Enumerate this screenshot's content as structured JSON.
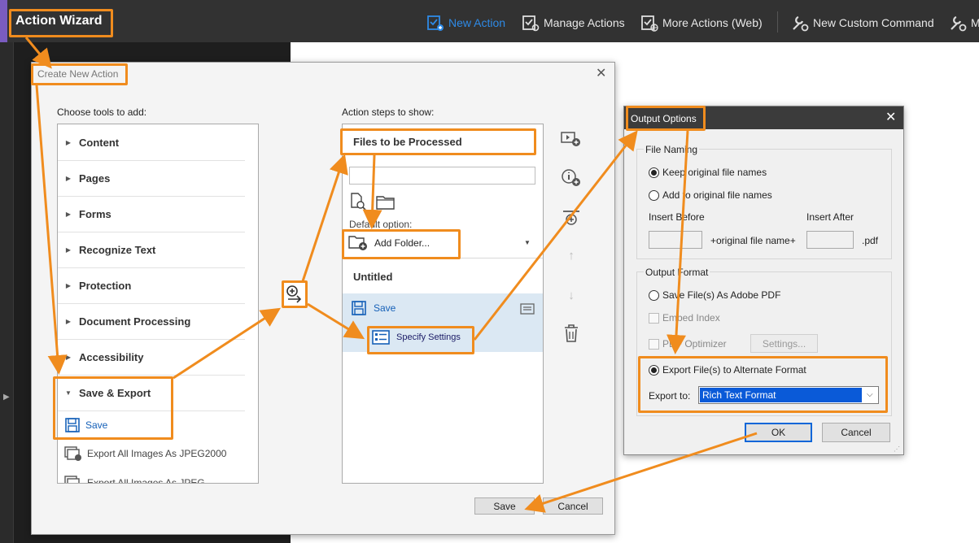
{
  "toolbar": {
    "title": "Action Wizard",
    "new_action": "New Action",
    "manage_actions": "Manage Actions",
    "more_actions": "More Actions (Web)",
    "new_custom_command": "New Custom Command",
    "cut_off_label": "M"
  },
  "create_dialog": {
    "title": "Create New Action",
    "choose_tools_label": "Choose tools to add:",
    "action_steps_label": "Action steps to show:",
    "categories": [
      "Content",
      "Pages",
      "Forms",
      "Recognize Text",
      "Protection",
      "Document Processing",
      "Accessibility",
      "Save & Export"
    ],
    "sub_items": [
      "Save",
      "Export All Images As JPEG2000",
      "Export All Images As JPEG"
    ],
    "files_header": "Files to be Processed",
    "default_option_label": "Default option:",
    "add_folder": "Add Folder...",
    "untitled": "Untitled",
    "step_save": "Save",
    "specify_settings": "Specify Settings",
    "save_button": "Save",
    "cancel_button": "Cancel"
  },
  "output_dialog": {
    "title": "Output Options",
    "file_naming": "File Naming",
    "keep_original": "Keep original file names",
    "add_to_original": "Add to original file names",
    "insert_before": "Insert Before",
    "insert_after": "Insert After",
    "original_file_name": "+original file name+",
    "pdf_ext": ".pdf",
    "output_format": "Output Format",
    "save_adobe_pdf": "Save File(s) As Adobe PDF",
    "embed_index": "Embed Index",
    "pdf_optimizer": "PDF Optimizer",
    "settings_button": "Settings...",
    "export_alternate": "Export File(s) to Alternate Format",
    "export_to_label": "Export to:",
    "export_to_value": "Rich Text Format",
    "ok_button": "OK",
    "cancel_button": "Cancel"
  },
  "colors": {
    "highlight": "#f08c1e",
    "toolbar_bg": "#323232",
    "accent_blue": "#2e8ae6",
    "selection_blue": "#1560b8"
  }
}
